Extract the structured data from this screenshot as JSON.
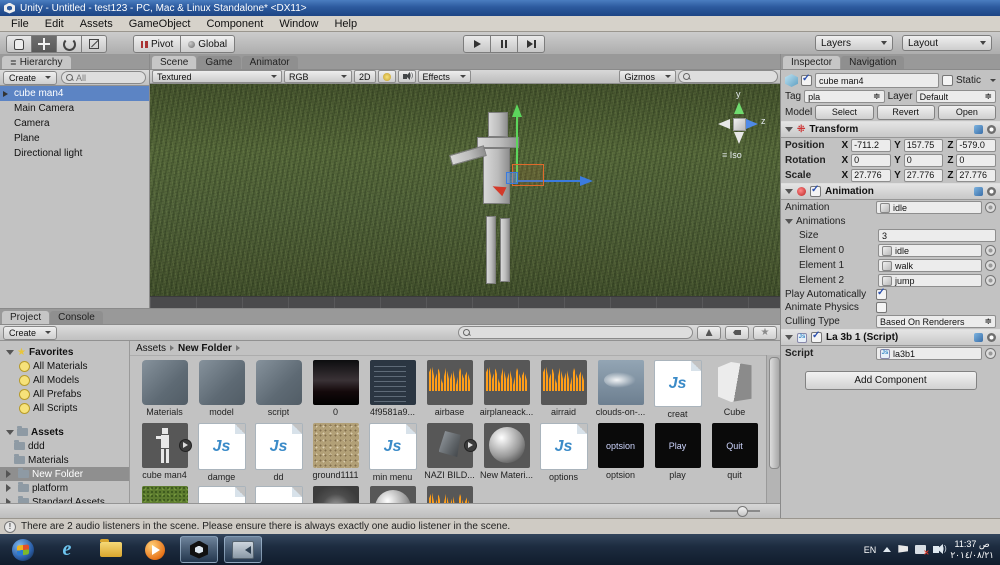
{
  "window": {
    "title": "Unity - Untitled - test123 - PC, Mac & Linux Standalone* <DX11>",
    "menus": [
      "File",
      "Edit",
      "Assets",
      "GameObject",
      "Component",
      "Window",
      "Help"
    ]
  },
  "toolbar": {
    "tools": [
      "hand-tool",
      "move-tool",
      "rotate-tool",
      "scale-tool"
    ],
    "active_tool": "move-tool",
    "pivot_label": "Pivot",
    "global_label": "Global",
    "layers_label": "Layers",
    "layout_label": "Layout"
  },
  "hierarchy": {
    "tab": "Hierarchy",
    "create_label": "Create",
    "search_placeholder": "All",
    "items": [
      {
        "label": "cube man4",
        "selected": true
      },
      {
        "label": "Main Camera",
        "selected": false
      },
      {
        "label": "Camera",
        "selected": false
      },
      {
        "label": "Plane",
        "selected": false
      },
      {
        "label": "Directional light",
        "selected": false
      }
    ]
  },
  "scene": {
    "tabs": [
      "Scene",
      "Game",
      "Animator"
    ],
    "shading_mode": "Textured",
    "render_channel": "RGB",
    "mode_2d": "2D",
    "effects_label": "Effects",
    "gizmos_label": "Gizmos",
    "view_label": "Iso",
    "axis_y": "y",
    "axis_z": "z"
  },
  "inspector": {
    "tabs": [
      "Inspector",
      "Navigation"
    ],
    "object_name": "cube man4",
    "static_label": "Static",
    "tag_label": "Tag",
    "tag_value": "pla",
    "layer_label": "Layer",
    "layer_value": "Default",
    "model_label": "Model",
    "model_buttons": [
      "Select",
      "Revert",
      "Open"
    ],
    "transform": {
      "title": "Transform",
      "rows": [
        {
          "label": "Position",
          "x": "-711.2",
          "y": "157.75",
          "z": "-579.0"
        },
        {
          "label": "Rotation",
          "x": "0",
          "y": "0",
          "z": "0"
        },
        {
          "label": "Scale",
          "x": "27.776",
          "y": "27.776",
          "z": "27.776"
        }
      ]
    },
    "animation": {
      "title": "Animation",
      "animation_label": "Animation",
      "animation_value": "idle",
      "animations_label": "Animations",
      "size_label": "Size",
      "size_value": "3",
      "elements": [
        {
          "label": "Element 0",
          "value": "idle"
        },
        {
          "label": "Element 1",
          "value": "walk"
        },
        {
          "label": "Element 2",
          "value": "jump"
        }
      ],
      "play_automatically_label": "Play Automatically",
      "play_automatically_checked": true,
      "animate_physics_label": "Animate Physics",
      "animate_physics_checked": false,
      "culling_type_label": "Culling Type",
      "culling_type_value": "Based On Renderers"
    },
    "script_component": {
      "title": "La 3b 1 (Script)",
      "script_label": "Script",
      "script_value": "la3b1"
    },
    "add_component_label": "Add Component"
  },
  "project": {
    "tabs": [
      "Project",
      "Console"
    ],
    "create_label": "Create",
    "breadcrumb": [
      "Assets",
      "New Folder"
    ],
    "favorites": {
      "label": "Favorites",
      "items": [
        "All Materials",
        "All Models",
        "All Prefabs",
        "All Scripts"
      ]
    },
    "assets_tree": {
      "label": "Assets",
      "items": [
        {
          "label": "ddd",
          "selected": false,
          "expandable": false
        },
        {
          "label": "Materials",
          "selected": false,
          "expandable": false
        },
        {
          "label": "New Folder",
          "selected": true,
          "expandable": true
        },
        {
          "label": "platform",
          "selected": false,
          "expandable": true
        },
        {
          "label": "Standard Assets",
          "selected": false,
          "expandable": true
        }
      ]
    },
    "grid": [
      [
        {
          "label": "Materials",
          "type": "folder"
        },
        {
          "label": "model",
          "type": "folder"
        },
        {
          "label": "script",
          "type": "folder"
        },
        {
          "label": "0",
          "type": "photo-dark"
        },
        {
          "label": "4f9581a9...",
          "type": "doc-dark"
        },
        {
          "label": "airbase",
          "type": "audio"
        },
        {
          "label": "airplaneack...",
          "type": "audio"
        },
        {
          "label": "airraid",
          "type": "audio"
        },
        {
          "label": "clouds-on-...",
          "type": "sky"
        },
        {
          "label": "creat",
          "type": "js"
        },
        {
          "label": "Cube",
          "type": "cube"
        }
      ],
      [
        {
          "label": "cube man4",
          "type": "model",
          "badge": true
        },
        {
          "label": "damge",
          "type": "js"
        },
        {
          "label": "dd",
          "type": "js"
        },
        {
          "label": "ground1111",
          "type": "sand"
        },
        {
          "label": "min menu",
          "type": "js"
        },
        {
          "label": "NAZI BILD...",
          "type": "model2",
          "badge": true
        },
        {
          "label": "New Materi...",
          "type": "sphere"
        },
        {
          "label": "options",
          "type": "js"
        },
        {
          "label": "optsion",
          "type": "black",
          "text": "optsion"
        },
        {
          "label": "play",
          "type": "black",
          "text": "Play"
        },
        {
          "label": "quit",
          "type": "black",
          "text": "Quit"
        }
      ],
      [
        {
          "label": "",
          "type": "grass"
        },
        {
          "label": "",
          "type": "js"
        },
        {
          "label": "",
          "type": "js"
        },
        {
          "label": "",
          "type": "noise"
        },
        {
          "label": "",
          "type": "sphere"
        },
        {
          "label": "",
          "type": "audio"
        }
      ]
    ]
  },
  "status_bar": {
    "message": "There are 2 audio listeners in the scene. Please ensure there is always exactly one audio listener in the scene."
  },
  "taskbar": {
    "language": "EN",
    "time": "ص 11:37",
    "date": "٢٠١٤/٠٨/٢١"
  },
  "colors": {
    "selection_blue": "#5c84c4",
    "selection_gray": "#8f8f8f",
    "waveform_orange": "#ff9e19",
    "gizmo_green": "#5cd65c",
    "gizmo_blue": "#3b7bde",
    "gizmo_red": "#d43a2a"
  }
}
